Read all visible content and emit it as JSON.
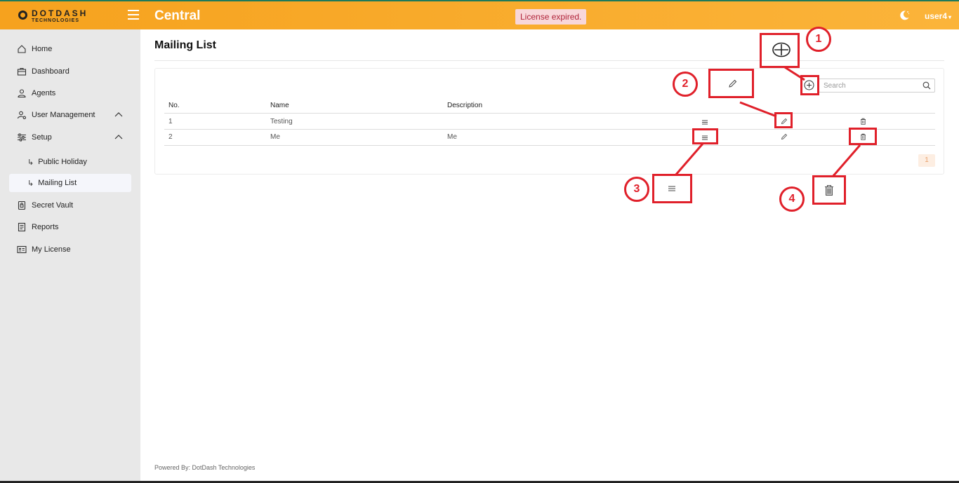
{
  "header": {
    "logo_main": "DOTDASH",
    "logo_sub": "TECHNOLOGIES",
    "app_title": "Central",
    "license_status": "License expired.",
    "user": "user4"
  },
  "sidebar": {
    "items": [
      {
        "label": "Home",
        "icon": "home-icon"
      },
      {
        "label": "Dashboard",
        "icon": "briefcase-icon"
      },
      {
        "label": "Agents",
        "icon": "user-icon"
      },
      {
        "label": "User Management",
        "icon": "user-settings-icon"
      },
      {
        "label": "Setup",
        "icon": "sliders-icon"
      },
      {
        "label": "Public Holiday",
        "icon": "sub-arrow-icon"
      },
      {
        "label": "Mailing List",
        "icon": "sub-arrow-icon"
      },
      {
        "label": "Secret Vault",
        "icon": "lock-icon"
      },
      {
        "label": "Reports",
        "icon": "report-icon"
      },
      {
        "label": "My License",
        "icon": "id-card-icon"
      }
    ]
  },
  "main": {
    "page_title": "Mailing List",
    "search_placeholder": "Search",
    "columns": [
      "No.",
      "Name",
      "Description"
    ],
    "rows": [
      {
        "no": "1",
        "name": "Testing",
        "description": ""
      },
      {
        "no": "2",
        "name": "Me",
        "description": "Me"
      }
    ],
    "pagination": {
      "current_page": "1"
    },
    "footer": "Powered By: DotDash Technologies"
  },
  "annotations": {
    "labels": [
      "1",
      "2",
      "3",
      "4"
    ],
    "color": "#e0202a"
  },
  "colors": {
    "header_bg": "#fbb43a",
    "license_badge_bg": "#f8d7da",
    "license_badge_text": "#b0243a",
    "sidebar_bg": "#e8e8e8",
    "annotation": "#e0202a"
  }
}
